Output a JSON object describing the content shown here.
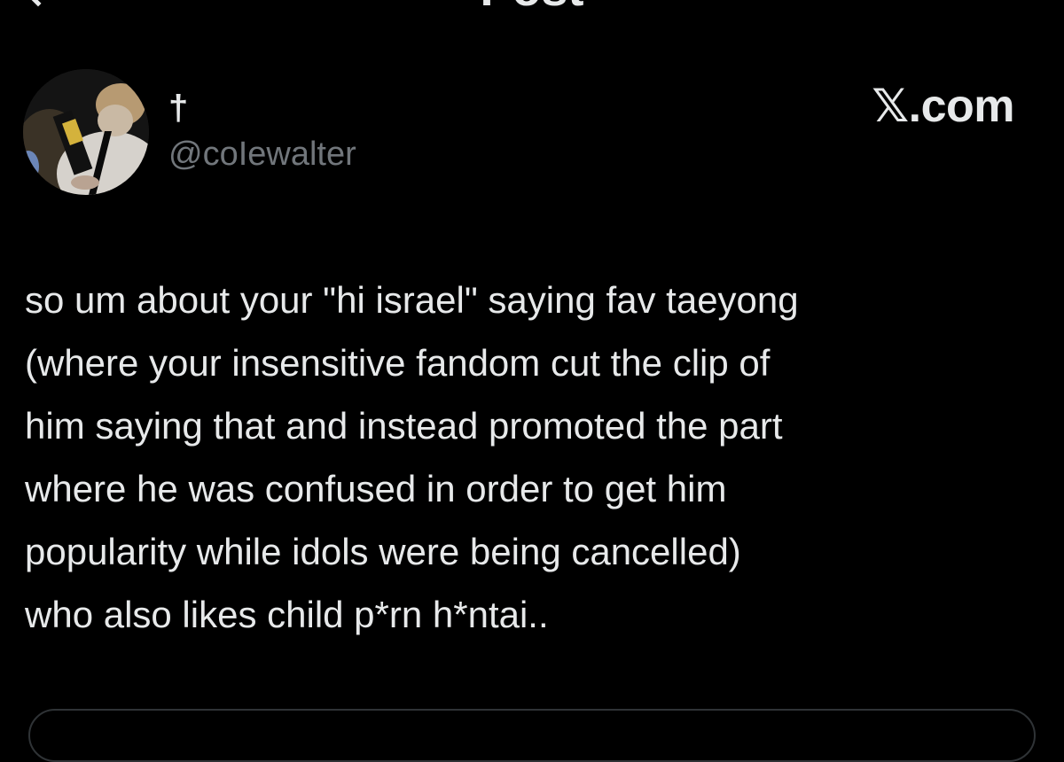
{
  "header": {
    "title": "Post"
  },
  "author": {
    "display_name": "†",
    "handle": "@coIewalter"
  },
  "brand": {
    "label": "𝕏.com"
  },
  "post": {
    "text": "so um about your \"hi israel\" saying fav taeyong\n(where your insensitive fandom cut the clip of\nhim saying that and instead promoted the part\nwhere he was confused in order to get him\npopularity while idols were being cancelled)\nwho also likes child p*rn h*ntai.."
  },
  "colors": {
    "background": "#000000",
    "primary_text": "#e7e9ea",
    "secondary_text": "#71767b",
    "border": "#2f3336"
  }
}
